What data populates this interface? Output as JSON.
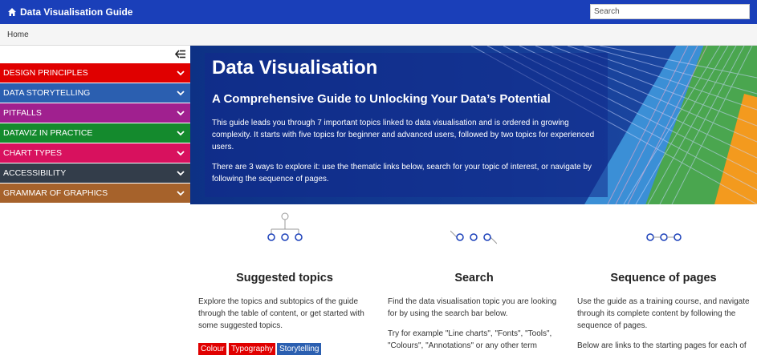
{
  "header": {
    "title": "Data Visualisation Guide",
    "brand_icon": "home-icon",
    "search_placeholder": "Search",
    "bg_color": "#1a3fb9"
  },
  "breadcrumb": {
    "home": "Home"
  },
  "sidebar": {
    "toggle_icon": "collapse-sidebar-icon",
    "items": [
      {
        "label": "DESIGN PRINCIPLES",
        "color": "#e00000"
      },
      {
        "label": "DATA STORYTELLING",
        "color": "#2b5fb0"
      },
      {
        "label": "PITFALLS",
        "color": "#a0208f"
      },
      {
        "label": "DATAVIZ IN PRACTICE",
        "color": "#148a2d"
      },
      {
        "label": "CHART TYPES",
        "color": "#d8115e"
      },
      {
        "label": "ACCESSIBILITY",
        "color": "#333d4a"
      },
      {
        "label": "GRAMMAR OF GRAPHICS",
        "color": "#a6622b"
      }
    ]
  },
  "hero": {
    "title": "Data Visualisation",
    "subtitle": "A Comprehensive Guide to Unlocking Your Data’s Potential",
    "p1": "This guide leads you through 7 important topics linked to data visualisation and is ordered in growing complexity. It starts with five topics for beginner and advanced users, followed by two topics for experienced users.",
    "p2": "There are 3 ways to explore it: use the thematic links below, search for your topic of interest, or navigate by following the sequence of pages."
  },
  "cards": {
    "suggested": {
      "icon": "tree-nodes-icon",
      "title": "Suggested topics",
      "text": "Explore the topics and subtopics of the guide through the table of content, or get started with some suggested topics.",
      "tags": [
        {
          "label": "Colour",
          "color": "#e00000"
        },
        {
          "label": "Typography",
          "color": "#e00000"
        },
        {
          "label": "Storytelling",
          "color": "#2b5fb0"
        }
      ]
    },
    "search": {
      "icon": "search-nodes-icon",
      "title": "Search",
      "text1": "Find the data visualisation topic you are looking for by using the search bar below.",
      "text2": "Try for example \"Line charts\", \"Fonts\", \"Tools\", \"Colours\", \"Annotations\" or any other term"
    },
    "sequence": {
      "icon": "sequence-nodes-icon",
      "title": "Sequence of pages",
      "text1": "Use the guide as a training course, and navigate through its complete content by following the sequence of pages.",
      "text2": "Below are links to the starting pages for each of"
    }
  },
  "colors": {
    "node_blue": "#1a3fb9",
    "node_line": "#999999"
  }
}
